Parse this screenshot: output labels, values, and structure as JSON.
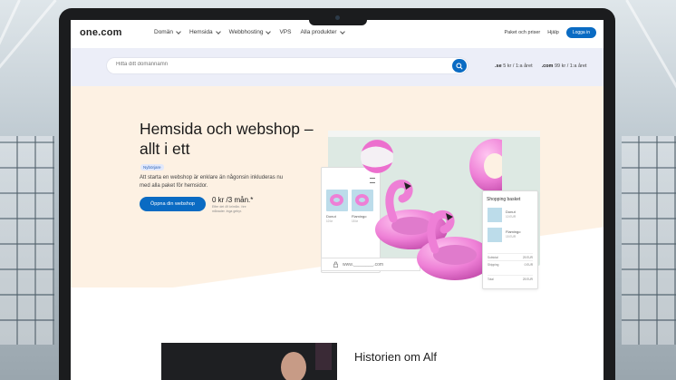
{
  "nav": {
    "logo": "one.com",
    "links": [
      "Domän",
      "Hemsida",
      "Webbhosting",
      "VPS",
      "Alla produkter"
    ],
    "right": [
      "Paket och priser",
      "Hjälp"
    ],
    "login": "Logga in"
  },
  "search": {
    "placeholder": "Hitta ditt domännamn",
    "prices": [
      {
        "tld": ".se",
        "price": "5 kr / 1:a året"
      },
      {
        "tld": ".com",
        "price": "99 kr / 1:a året"
      }
    ]
  },
  "hero": {
    "title": "Hemsida och webshop – allt i ett",
    "tag": "Nybörjare",
    "description": "Att starta en webshop är enklare än någonsin inkluderas nu med alla paket för hemsidor.",
    "cta": "Öppna din webshop",
    "price": "0 kr /3 mån.*",
    "price_note": "Efter det 49 kr/mån. i tre månader. Inga gebyr."
  },
  "mockup": {
    "phone_items": [
      {
        "name": "Donut",
        "price": "10 kr"
      },
      {
        "name": "Flamingo",
        "price": "15 kr"
      }
    ],
    "url": "www.________.com",
    "basket": {
      "title": "Shopping basket",
      "items": [
        {
          "name": "Donut",
          "price": "10 EUR"
        },
        {
          "name": "Flamingo",
          "price": "15 EUR"
        }
      ],
      "rows": [
        {
          "label": "Subtotal",
          "value": "25 EUR"
        },
        {
          "label": "Shipping",
          "value": "0 EUR"
        },
        {
          "label": "Total",
          "value": "25 EUR"
        }
      ]
    }
  },
  "story": {
    "title": "Historien om Alf"
  },
  "colors": {
    "accent": "#0a6bc3",
    "hero_bg": "#fdf1e3",
    "search_bg": "#eceef8",
    "pink": "#ee7fd6"
  }
}
